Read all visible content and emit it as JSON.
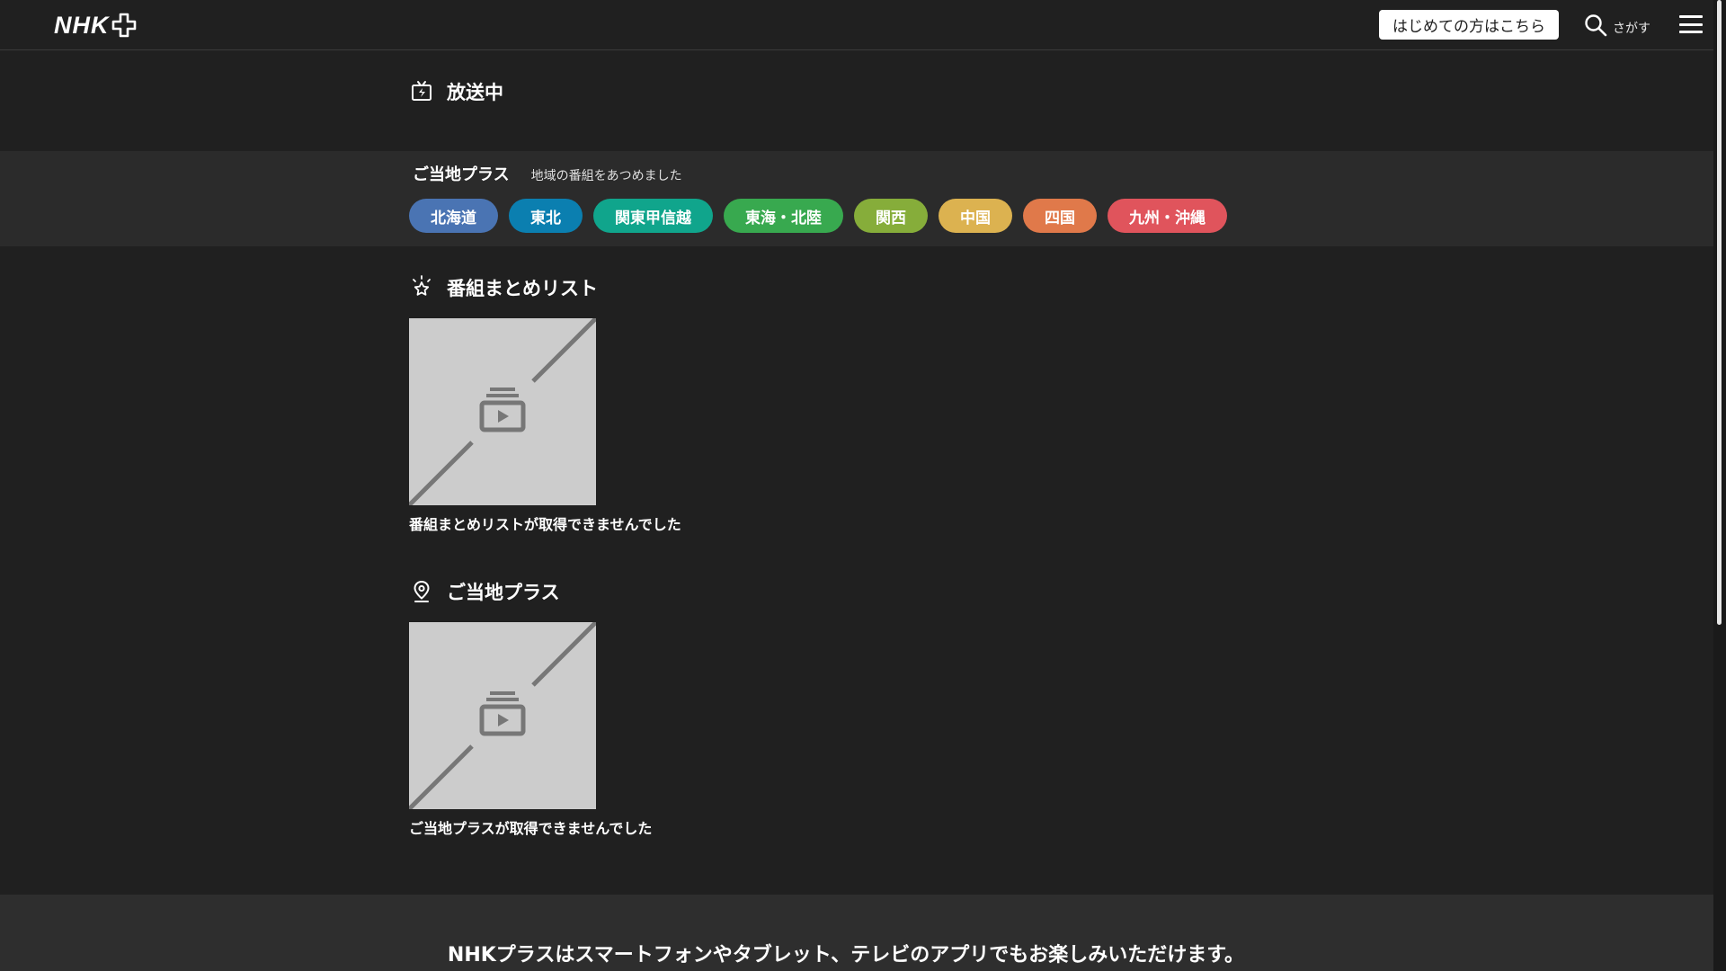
{
  "header": {
    "logo_text": "NHK",
    "first_time_button": "はじめての方はこちら",
    "search_label": "さがす",
    "icons": {
      "logo_plus": "plus-logo-icon",
      "search": "search-icon",
      "menu": "hamburger-menu-icon"
    }
  },
  "on_air": {
    "title": "放送中",
    "icon": "live-tv-icon"
  },
  "regional": {
    "title": "ご当地プラス",
    "subtitle": "地域の番組をあつめました",
    "regions": [
      {
        "label": "北海道",
        "color": "#4a74b3"
      },
      {
        "label": "東北",
        "color": "#0b7fb0"
      },
      {
        "label": "関東甲信越",
        "color": "#10a58c"
      },
      {
        "label": "東海・北陸",
        "color": "#38a94f"
      },
      {
        "label": "関西",
        "color": "#86ad3a"
      },
      {
        "label": "中国",
        "color": "#dcb250"
      },
      {
        "label": "四国",
        "color": "#e0794a"
      },
      {
        "label": "九州・沖縄",
        "color": "#e0545c"
      }
    ]
  },
  "program_list": {
    "title": "番組まとめリスト",
    "icon": "sparkle-star-icon",
    "error": "番組まとめリストが取得できませんでした"
  },
  "local_plus": {
    "title": "ご当地プラス",
    "icon": "location-pin-icon",
    "error": "ご当地プラスが取得できませんでした"
  },
  "footer": {
    "text": "NHKプラスはスマートフォンやタブレット、テレビのアプリでもお楽しみいただけます。"
  }
}
